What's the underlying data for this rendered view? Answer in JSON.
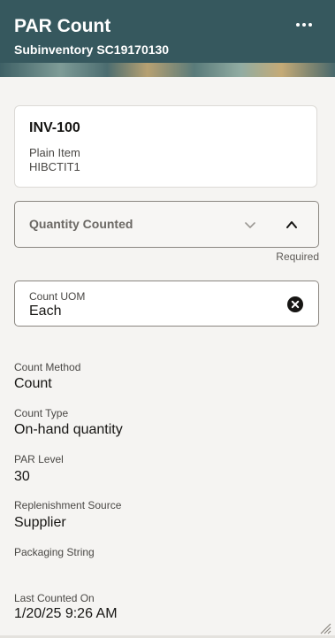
{
  "header": {
    "title": "PAR Count",
    "subtitle": "Subinventory SC19170130",
    "more_icon": "more-horizontal-icon"
  },
  "item": {
    "code": "INV-100",
    "description": "Plain Item",
    "sub": "HIBCTIT1"
  },
  "quantity": {
    "label": "Quantity Counted",
    "required_text": "Required",
    "icons": [
      "chevron-down-icon",
      "chevron-up-icon"
    ]
  },
  "count_uom": {
    "label": "Count UOM",
    "value": "Each",
    "clear_icon": "clear-icon"
  },
  "details": {
    "count_method_label": "Count Method",
    "count_method_value": "Count",
    "count_type_label": "Count Type",
    "count_type_value": "On-hand quantity",
    "par_level_label": "PAR Level",
    "par_level_value": "30",
    "replenishment_source_label": "Replenishment Source",
    "replenishment_source_value": "Supplier",
    "packaging_string_label": "Packaging String",
    "packaging_string_value": "",
    "last_counted_label": "Last Counted On",
    "last_counted_value": "1/20/25 9:26 AM"
  },
  "colors": {
    "header_bg": "#36585e",
    "page_bg": "#f5f4f2",
    "card_bg": "#ffffff"
  }
}
